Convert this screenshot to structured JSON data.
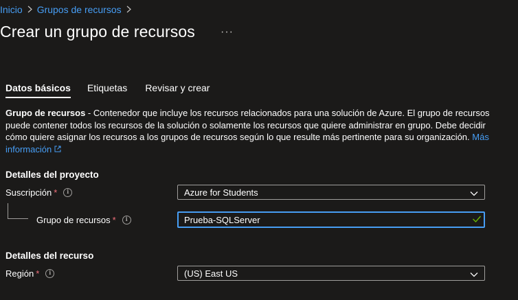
{
  "breadcrumb": {
    "home": "Inicio",
    "parent": "Grupos de recursos"
  },
  "header": {
    "title": "Crear un grupo de recursos",
    "more": "···"
  },
  "tabs": [
    {
      "label": "Datos básicos",
      "active": true
    },
    {
      "label": "Etiquetas",
      "active": false
    },
    {
      "label": "Revisar y crear",
      "active": false
    }
  ],
  "description": {
    "bold": "Grupo de recursos",
    "text": " - Contenedor que incluye los recursos relacionados para una solución de Azure. El grupo de recursos puede contener todos los recursos de la solución o solamente los recursos que quiere administrar en grupo. Debe decidir cómo quiere asignar los recursos a los grupos de recursos según lo que resulte más pertinente para su organización. ",
    "link": "Más información"
  },
  "project": {
    "heading": "Detalles del proyecto",
    "subscription_label": "Suscripción",
    "subscription_value": "Azure for Students",
    "rg_label": "Grupo de recursos",
    "rg_value": "Prueba-SQLServer"
  },
  "resource": {
    "heading": "Detalles del recurso",
    "region_label": "Región",
    "region_value": "(US) East US"
  },
  "common": {
    "required_mark": "*",
    "info_glyph": "i"
  },
  "colors": {
    "background": "#1b1a19",
    "link": "#479ef5",
    "required": "#f1707b",
    "focus": "#479ef5",
    "valid": "#6bb700"
  }
}
